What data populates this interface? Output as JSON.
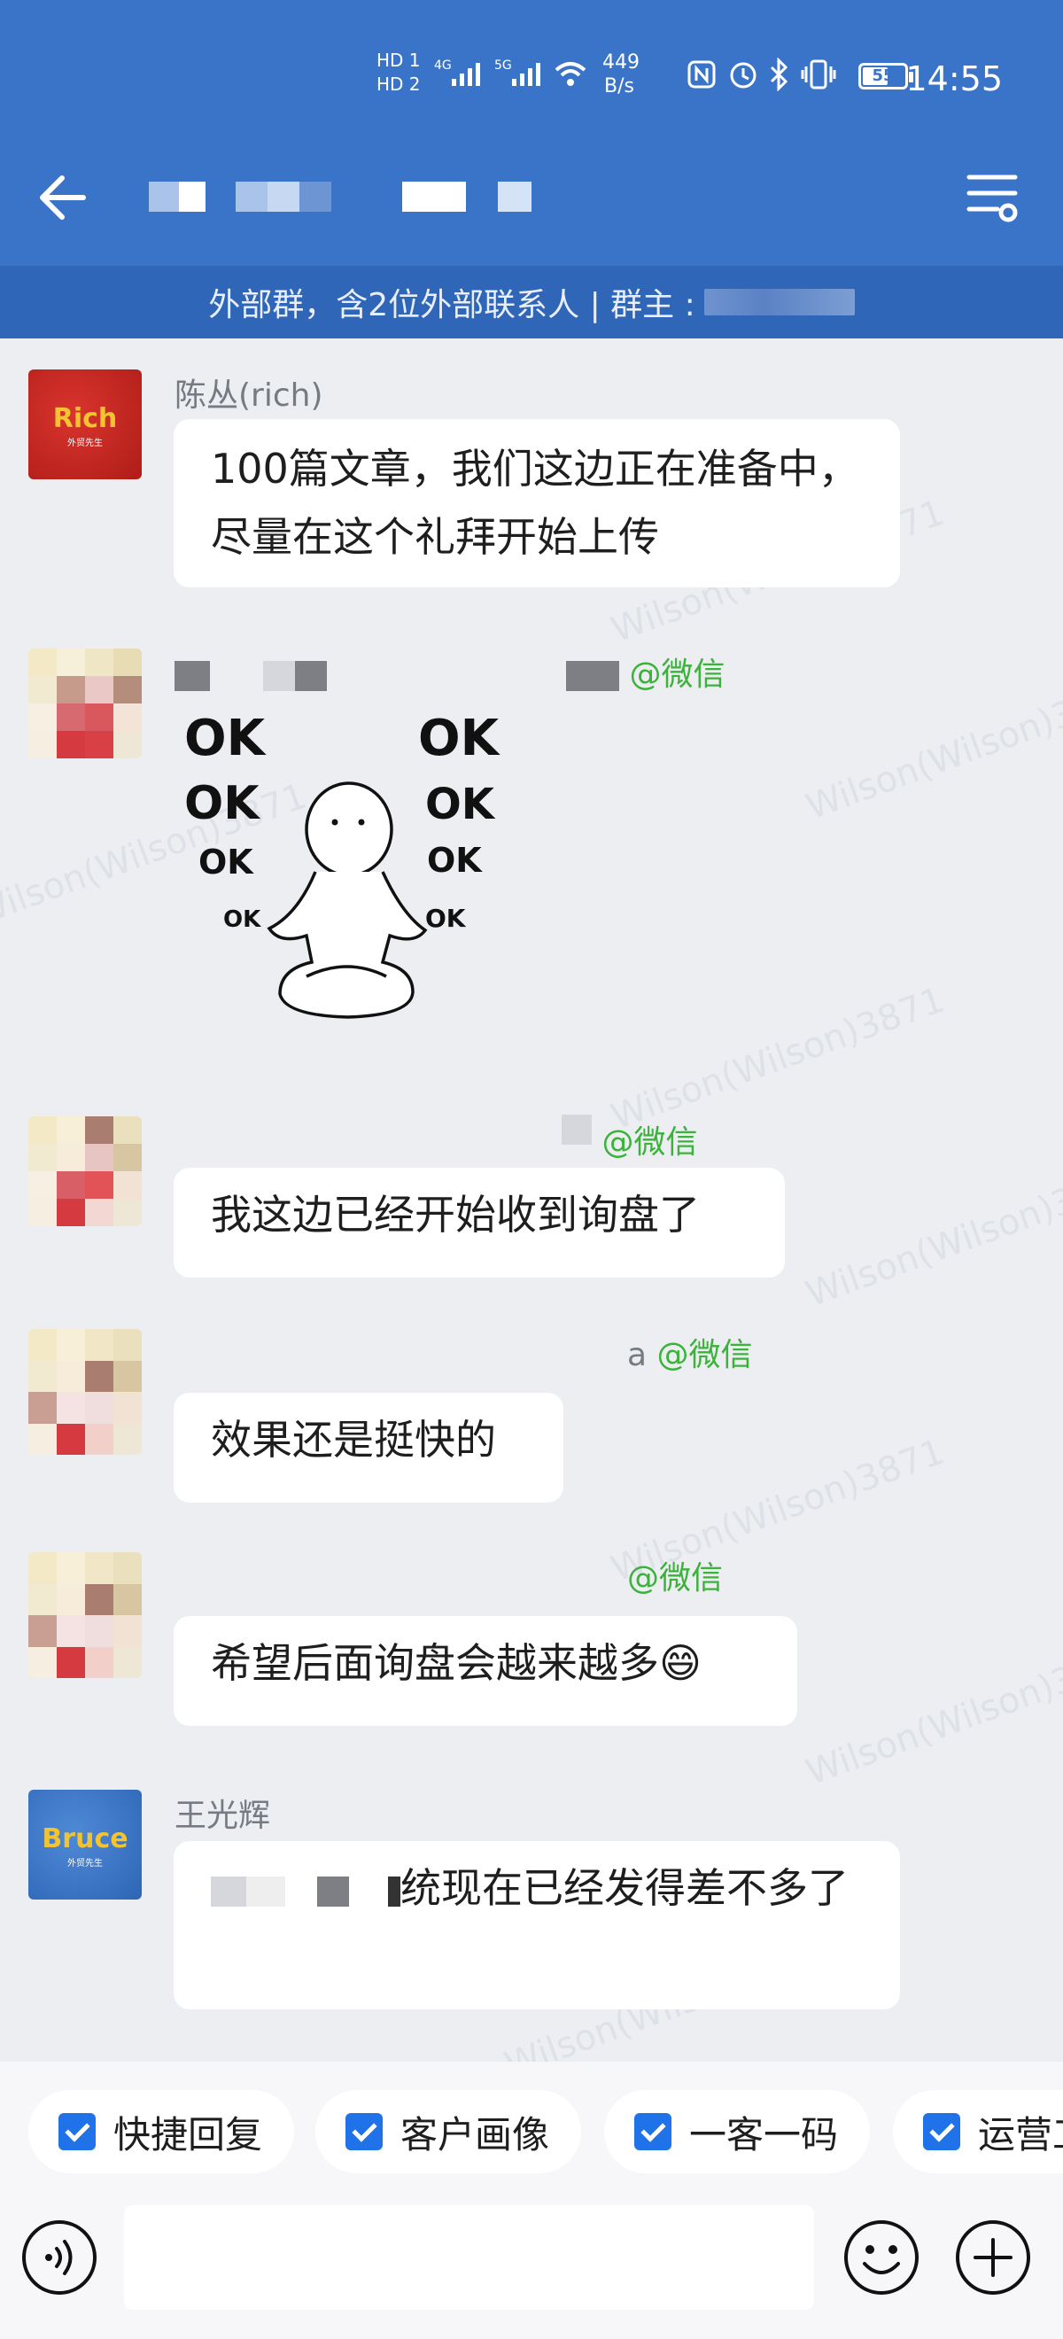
{
  "status_bar": {
    "hd1": "HD 1",
    "hd2": "HD 2",
    "net1": "4G",
    "net2": "5G",
    "speed_value": "449",
    "speed_unit": "B/s",
    "battery": "55",
    "time": "14:55"
  },
  "header": {
    "back_icon": "arrow-left-icon",
    "menu_icon": "chat-settings-icon"
  },
  "notice": {
    "text": "外部群，含2位外部联系人 | 群主 : "
  },
  "messages": [
    {
      "sender": "陈丛(rich)",
      "wechat_tag": "",
      "avatar_text": "Rich",
      "avatar_sub": "外贸先生",
      "text": "100篇文章，我们这边正在准备中，尽量在这个礼拜开始上传"
    },
    {
      "sender": "",
      "wechat_tag": "@微信",
      "text": "",
      "sticker_labels": [
        "OK",
        "OK",
        "OK",
        "OK",
        "OK",
        "OK",
        "OK",
        "OK"
      ]
    },
    {
      "sender": "",
      "wechat_tag": "@微信",
      "text": "我这边已经开始收到询盘了"
    },
    {
      "sender": "a",
      "wechat_tag": "@微信",
      "text": "效果还是挺快的"
    },
    {
      "sender": "",
      "wechat_tag": "@微信",
      "text": "希望后面询盘会越来越多😄"
    },
    {
      "sender": "王光辉",
      "wechat_tag": "",
      "avatar_text": "Bruce",
      "avatar_sub": "外贸先生",
      "text_visible": "统现在已经发得差不多了"
    }
  ],
  "watermark": "Wilson(Wilson)3871",
  "quick_tools": [
    {
      "label": "快捷回复"
    },
    {
      "label": "客户画像"
    },
    {
      "label": "一客一码"
    },
    {
      "label": "运营工"
    }
  ],
  "composer": {
    "voice_icon": "voice-input-icon",
    "emoji_icon": "emoji-icon",
    "plus_icon": "plus-icon",
    "placeholder": ""
  },
  "colors": {
    "header_bg": "#3a74c9",
    "notice_bg": "#2f66b8",
    "chat_bg": "#eceef2",
    "wechat_green": "#3bb33b",
    "checkbox_blue": "#1f72e8"
  }
}
